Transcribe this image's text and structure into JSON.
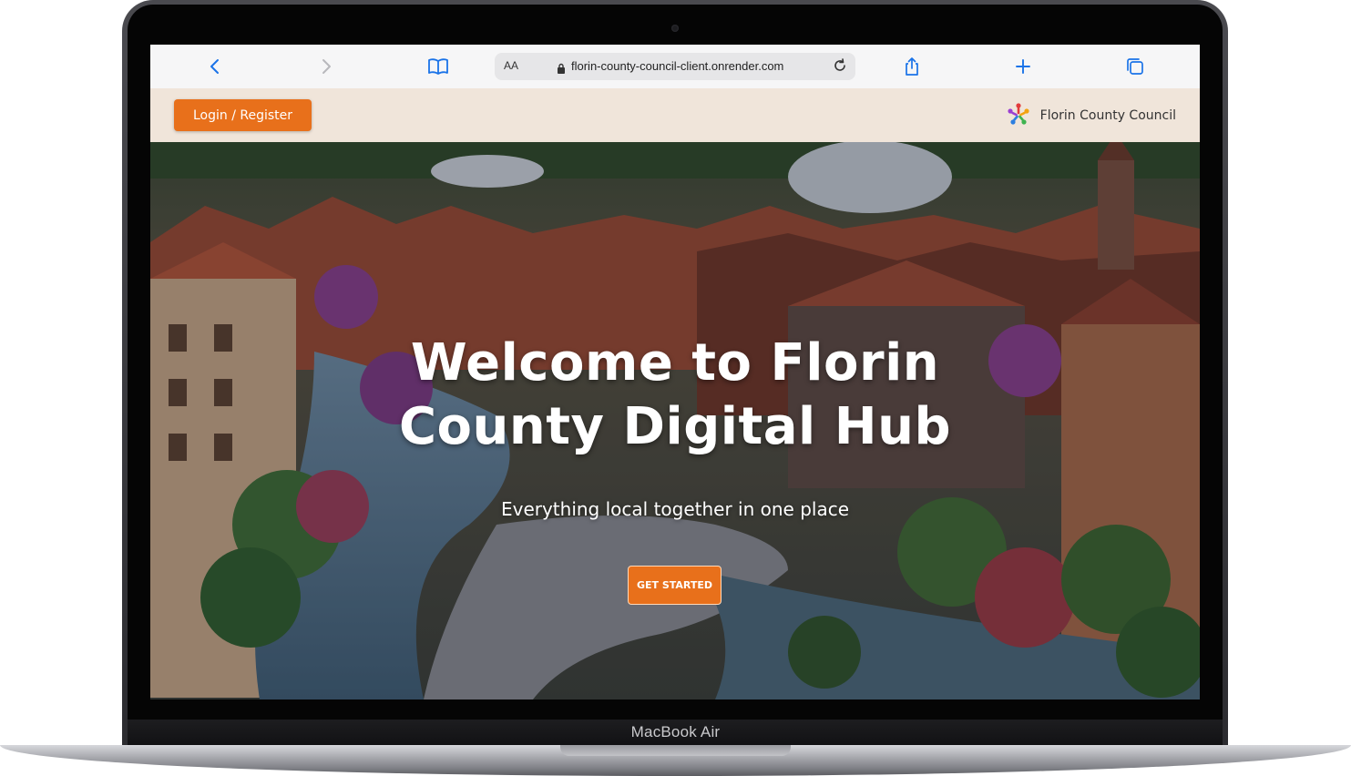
{
  "device": {
    "label": "MacBook Air"
  },
  "browser": {
    "text_size_label": "AA",
    "url": "florin-county-council-client.onrender.com",
    "icons": {
      "back": "chevron-left-icon",
      "forward": "chevron-right-icon",
      "bookmarks": "book-icon",
      "lock": "lock-icon",
      "reload": "reload-icon",
      "share": "share-icon",
      "new_tab": "plus-icon",
      "tabs": "tabs-icon"
    },
    "accent": "#1a73e8"
  },
  "header": {
    "login_label": "Login / Register",
    "site_name": "Florin County Council",
    "logo_icon": "people-circle-logo-icon",
    "background": "#f0e5da"
  },
  "hero": {
    "title_line1": "Welcome to Florin",
    "title_line2": "County Digital Hub",
    "subtitle": "Everything local together in one place",
    "cta_label": "GET STARTED"
  },
  "colors": {
    "brand_orange": "#e8701b"
  }
}
